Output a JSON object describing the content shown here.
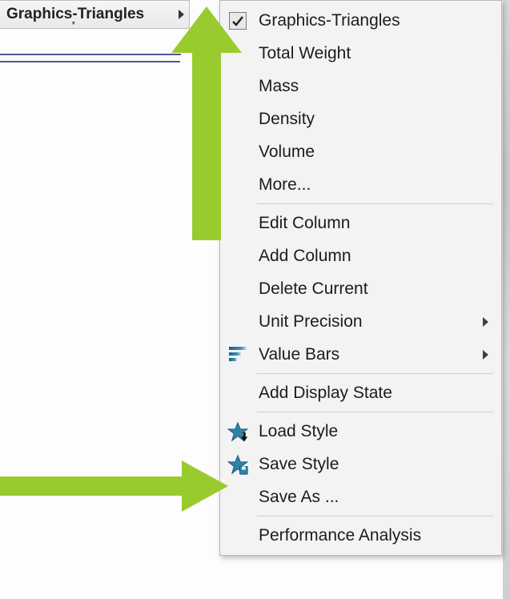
{
  "column_header": {
    "label": "Graphics-Triangles"
  },
  "menu": {
    "groups": [
      [
        {
          "id": "graphics-triangles",
          "label": "Graphics-Triangles",
          "checked": true
        },
        {
          "id": "total-weight",
          "label": "Total Weight"
        },
        {
          "id": "mass",
          "label": "Mass"
        },
        {
          "id": "density",
          "label": "Density"
        },
        {
          "id": "volume",
          "label": "Volume"
        },
        {
          "id": "more",
          "label": "More..."
        }
      ],
      [
        {
          "id": "edit-column",
          "label": "Edit Column"
        },
        {
          "id": "add-column",
          "label": "Add Column"
        },
        {
          "id": "delete-current",
          "label": "Delete Current"
        },
        {
          "id": "unit-precision",
          "label": "Unit Precision",
          "submenu": true
        },
        {
          "id": "value-bars",
          "label": "Value Bars",
          "submenu": true,
          "icon": "valuebars"
        }
      ],
      [
        {
          "id": "add-display-state",
          "label": "Add Display State"
        }
      ],
      [
        {
          "id": "load-style",
          "label": "Load Style",
          "icon": "star-load"
        },
        {
          "id": "save-style",
          "label": "Save Style",
          "icon": "star-save"
        },
        {
          "id": "save-as",
          "label": "Save As ..."
        }
      ],
      [
        {
          "id": "performance-analysis",
          "label": "Performance Analysis"
        }
      ]
    ]
  },
  "annotations": {
    "arrow_color": "#9acb2e"
  }
}
